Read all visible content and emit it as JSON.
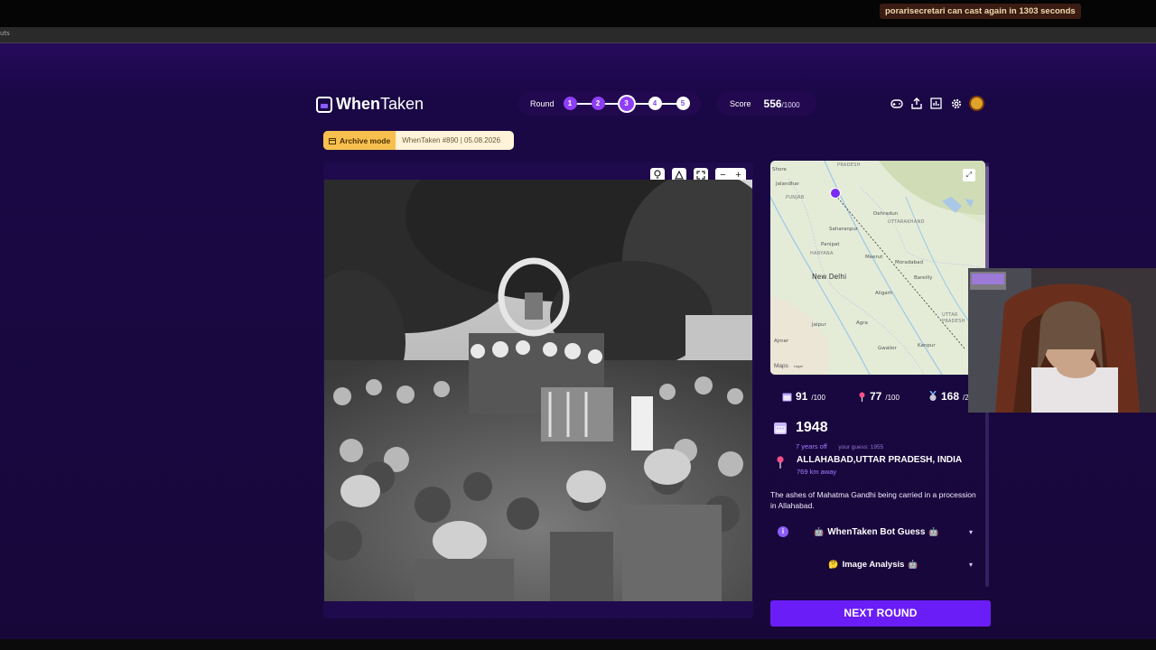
{
  "stream": {
    "cooldown_text": "porarisecretari can cast again in 1303 seconds",
    "browser_tab_fragment": "uts"
  },
  "header": {
    "logo_bold": "When",
    "logo_light": "Taken",
    "round_label": "Round",
    "rounds": [
      {
        "num": "1",
        "state": "done"
      },
      {
        "num": "2",
        "state": "done"
      },
      {
        "num": "3",
        "state": "current"
      },
      {
        "num": "4",
        "state": "todo"
      },
      {
        "num": "5",
        "state": "todo"
      }
    ],
    "score_label": "Score",
    "score_value": "556",
    "score_max": "/1000",
    "icons": [
      "gamepad-icon",
      "share-icon",
      "stats-icon",
      "settings-icon",
      "avatar-icon"
    ]
  },
  "archive": {
    "mode_label": "Archive mode",
    "game_info": "WhenTaken #890 | 05.08.2026"
  },
  "photo_tools": {
    "hint": "hint-icon",
    "report": "warning-icon",
    "fullscreen": "fullscreen-icon",
    "zoom_out": "−",
    "zoom_in": "+"
  },
  "map": {
    "attribution": "Maps",
    "legal": "Legal",
    "labels": [
      {
        "text": "PRADESH",
        "kind": "state"
      },
      {
        "text": "Jalandhar",
        "kind": "city"
      },
      {
        "text": "PUNJAB",
        "kind": "state"
      },
      {
        "text": "Dehradun",
        "kind": "city"
      },
      {
        "text": "UTTARAKHAND",
        "kind": "state"
      },
      {
        "text": "Saharanpur",
        "kind": "city"
      },
      {
        "text": "Panipat",
        "kind": "city"
      },
      {
        "text": "HARYANA",
        "kind": "state"
      },
      {
        "text": "Meerut",
        "kind": "city"
      },
      {
        "text": "Moradabad",
        "kind": "city"
      },
      {
        "text": "Bareilly",
        "kind": "city"
      },
      {
        "text": "New Delhi",
        "kind": "big"
      },
      {
        "text": "Aligarh",
        "kind": "city"
      },
      {
        "text": "UTTAR PRADESH",
        "kind": "state"
      },
      {
        "text": "Jaipur",
        "kind": "city"
      },
      {
        "text": "Agra",
        "kind": "city"
      },
      {
        "text": "Ajmer",
        "kind": "city"
      },
      {
        "text": "Gwalior",
        "kind": "city"
      },
      {
        "text": "Kanpur",
        "kind": "city"
      },
      {
        "text": "Shore",
        "kind": "city"
      }
    ]
  },
  "stats": {
    "year_score": "91",
    "location_score": "77",
    "third_score": "168",
    "max": "/100",
    "third_max_fragment": "/2"
  },
  "answer": {
    "year": "1948",
    "year_off": "7 years off",
    "your_guess": "your guess: 1955",
    "location": "ALLAHABAD,UTTAR PRADESH, INDIA",
    "distance": "769 km away",
    "description": "The ashes of Mahatma Gandhi being carried in a procession in Allahabad."
  },
  "accordions": [
    {
      "label": "WhenTaken Bot Guess"
    },
    {
      "label": "Image Analysis"
    }
  ],
  "next_button": "NEXT ROUND",
  "colors": {
    "background": "#190840",
    "accent": "#6a1df7",
    "step_done": "#8f3ef7",
    "archive_tag": "#f7c04e"
  }
}
